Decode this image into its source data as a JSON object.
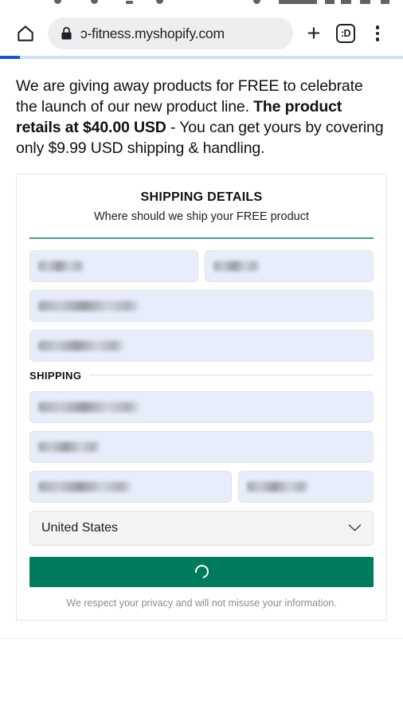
{
  "statusbar": {
    "visible": true,
    "note": "cut-off android status bar icons"
  },
  "browser": {
    "home_icon": "home-icon",
    "lock_icon": "lock-icon",
    "url": "ɔ-fitness.myshopify.com",
    "new_tab_label": "+",
    "tab_count_label": ":D",
    "menu_icon": "kebab-menu-icon",
    "progress_percent": 5,
    "progress_color": "#1a56c4"
  },
  "page": {
    "headline": {
      "part1": "We are giving away products for FREE to celebrate the launch of our new product line. ",
      "bold": "The product retails at $40.00 USD",
      "part2": " - You can get yours by covering only $9.99 USD shipping & handling."
    },
    "card": {
      "title": "SHIPPING DETAILS",
      "subtitle": "Where should we ship your FREE product",
      "accent_color": "#4a9a94",
      "fields": [
        {
          "name": "first-name-field",
          "value": "",
          "redacted": true,
          "width": "half"
        },
        {
          "name": "last-name-field",
          "value": "",
          "redacted": true,
          "width": "half"
        },
        {
          "name": "email-field",
          "value": "",
          "redacted": true,
          "width": "full"
        },
        {
          "name": "phone-field",
          "value": "",
          "redacted": true,
          "width": "full"
        }
      ],
      "shipping_section_label": "SHIPPING",
      "shipping_fields": [
        {
          "name": "address-field",
          "value": "",
          "redacted": true,
          "width": "full"
        },
        {
          "name": "address2-field",
          "value": "",
          "redacted": true,
          "width": "full"
        },
        {
          "name": "city-field",
          "value": "",
          "redacted": true,
          "width": "w60"
        },
        {
          "name": "zip-field",
          "value": "",
          "redacted": true,
          "width": "w40"
        }
      ],
      "country_select": {
        "label": "country-select",
        "value": "United States",
        "options": [
          "United States"
        ]
      },
      "submit": {
        "label": "",
        "state": "loading",
        "color": "#007a5c",
        "spinner": "loading-spinner"
      },
      "privacy_note": "We respect your privacy and will not misuse your information."
    }
  }
}
